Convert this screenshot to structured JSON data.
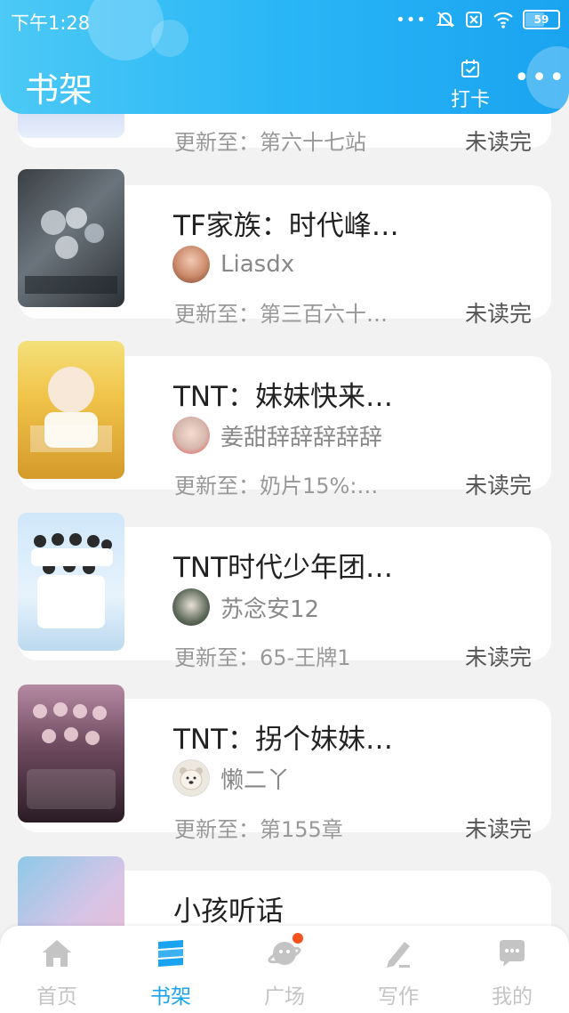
{
  "status_bar": {
    "time": "下午1:28",
    "battery": "59"
  },
  "header": {
    "title": "书架",
    "checkin_label": "打卡",
    "more_label": "•••"
  },
  "books": [
    {
      "title": "",
      "author": "",
      "update": "更新至：第六十七站",
      "status": "未读完"
    },
    {
      "title": "TF家族：时代峰…",
      "author": "Liasdx",
      "update": "更新至：第三百六十…",
      "status": "未读完"
    },
    {
      "title": "TNT：妹妹快来…",
      "author": "姜甜辞辞辞辞辞",
      "update": "更新至：奶片15%:…",
      "status": "未读完"
    },
    {
      "title": "TNT时代少年团…",
      "author": "苏念安12",
      "update": "更新至：65-王牌1",
      "status": "未读完"
    },
    {
      "title": "TNT：拐个妹妹…",
      "author": "懒二丫",
      "update": "更新至：第155章",
      "status": "未读完"
    },
    {
      "title": "小孩听话",
      "author": "",
      "update": "",
      "status": ""
    }
  ],
  "nav": [
    {
      "label": "首页",
      "icon": "home-icon"
    },
    {
      "label": "书架",
      "icon": "bookshelf-icon",
      "active": true
    },
    {
      "label": "广场",
      "icon": "planet-icon",
      "badge": true
    },
    {
      "label": "写作",
      "icon": "pen-icon"
    },
    {
      "label": "我的",
      "icon": "chat-bubble-icon"
    }
  ],
  "colors": {
    "accent": "#1aa3f0",
    "header_start": "#4cc9f5",
    "badge": "#f4511e"
  }
}
